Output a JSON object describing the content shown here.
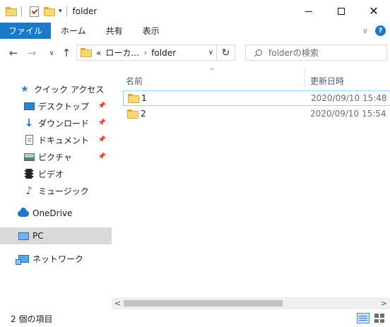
{
  "window": {
    "title": "folder",
    "minimize_icon": "minimize-icon",
    "maximize_icon": "maximize-icon",
    "close_glyph": "✕"
  },
  "qat": {
    "dropdown_glyph": "▾"
  },
  "ribbon": {
    "tabs": [
      {
        "label": "ファイル",
        "active": true
      },
      {
        "label": "ホーム"
      },
      {
        "label": "共有"
      },
      {
        "label": "表示"
      }
    ],
    "expand_glyph": "∨",
    "help_glyph": "?"
  },
  "nav": {
    "back_glyph": "←",
    "forward_glyph": "→",
    "recent_glyph": "∨",
    "up_glyph": "↑",
    "address": {
      "overflow": "«",
      "crumb1": "ローカ...",
      "separator": "›",
      "crumb2": "folder",
      "dropdown_glyph": "∨",
      "refresh_glyph": "↻"
    },
    "search": {
      "placeholder": "folderの検索"
    }
  },
  "sidebar": {
    "pin_glyph": "📌",
    "items": [
      {
        "label": "クイック アクセス",
        "icon": "star-icon"
      },
      {
        "label": "デスクトップ",
        "icon": "desktop-icon",
        "pinned": true
      },
      {
        "label": "ダウンロード",
        "icon": "download-icon",
        "pinned": true
      },
      {
        "label": "ドキュメント",
        "icon": "document-icon",
        "pinned": true
      },
      {
        "label": "ピクチャ",
        "icon": "pictures-icon",
        "pinned": true
      },
      {
        "label": "ビデオ",
        "icon": "video-icon"
      },
      {
        "label": "ミュージック",
        "icon": "music-icon"
      },
      {
        "label": "OneDrive",
        "icon": "onedrive-icon"
      },
      {
        "label": "PC",
        "icon": "pc-icon",
        "selected": true
      },
      {
        "label": "ネットワーク",
        "icon": "network-icon"
      }
    ]
  },
  "content": {
    "sort_glyph": "^",
    "columns": [
      {
        "label": "名前"
      },
      {
        "label": "更新日時"
      }
    ],
    "rows": [
      {
        "name": "1",
        "modified": "2020/09/10 15:48",
        "focused": true
      },
      {
        "name": "2",
        "modified": "2020/09/10 15:54"
      }
    ]
  },
  "scrollbar": {
    "left_glyph": "<",
    "right_glyph": ">"
  },
  "status": {
    "text": "2 個の項目"
  },
  "colors": {
    "accent": "#1979ca",
    "folder": "#f8d775",
    "selected_bg": "#d9d9d9",
    "focus_border": "#99d1ff"
  }
}
